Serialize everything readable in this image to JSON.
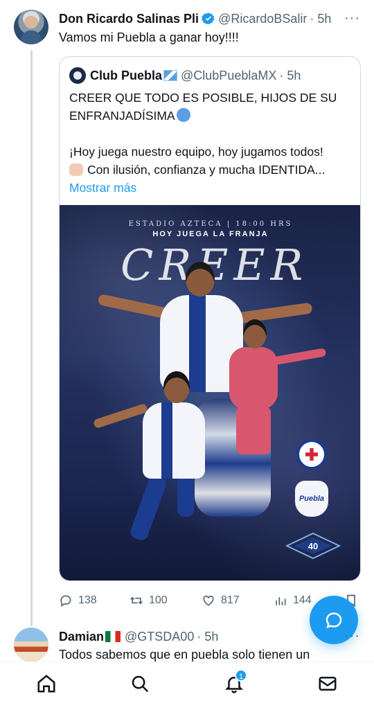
{
  "tweet": {
    "author_name": "Don Ricardo Salinas Pli",
    "handle": "@RicardoBSalir",
    "time": "· 5h",
    "more": "···",
    "text": "Vamos mi Puebla a ganar hoy!!!!"
  },
  "quote": {
    "author_name": "Club Puebla",
    "handle": "@ClubPueblaMX",
    "time": "· 5h",
    "line1": "CREER QUE TODO ES POSIBLE, HIJOS DE SU",
    "line2": "ENFRANJADÍSIMA",
    "line3": "¡Hoy juega nuestro equipo, hoy jugamos todos!",
    "line4": "Con ilusión, confianza y mucha IDENTIDA...",
    "more_link": "Mostrar más",
    "poster": {
      "venue": "ESTADIO AZTECA | 18:00 HRS",
      "headline": "HOY JUEGA LA FRANJA",
      "script": "CREER",
      "badge_puebla": "Puebla",
      "badge_40": "40"
    }
  },
  "actions": {
    "replies": "138",
    "retweets": "100",
    "likes": "817",
    "views": "144"
  },
  "reply": {
    "author_name": "Damian",
    "handle": "@GTSDA00",
    "time": "· 5h",
    "more": "···",
    "text": "Todos sabemos que en puebla solo tienen un"
  },
  "nav": {
    "notifications_count": "1"
  },
  "colors": {
    "accent": "#1d9bf0",
    "text_primary": "#0f1419",
    "text_secondary": "#536471",
    "border": "#cfd9de"
  }
}
